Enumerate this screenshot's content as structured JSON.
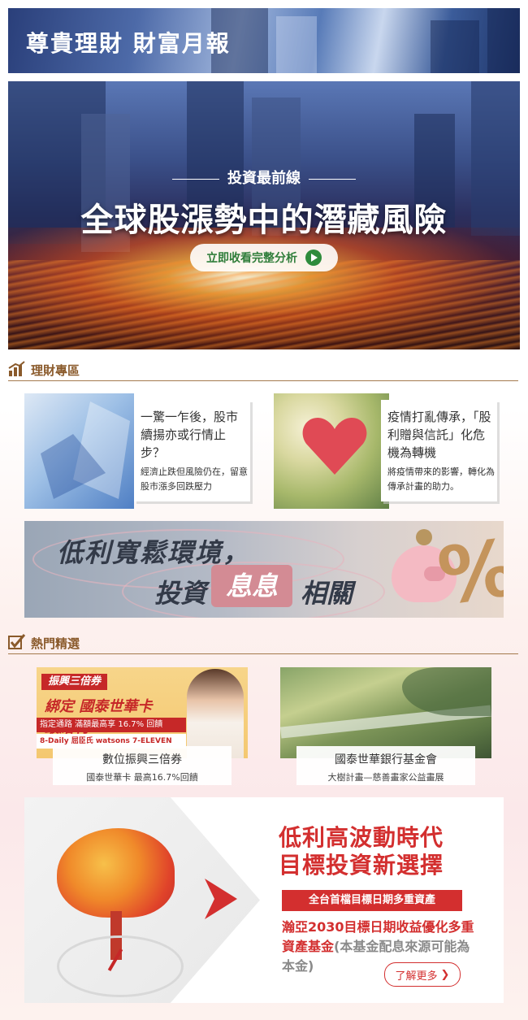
{
  "header": {
    "title": "尊貴理財 財富月報"
  },
  "hero": {
    "kicker": "投資最前線",
    "headline": "全球股漲勢中的潛藏風險",
    "cta_label": "立即收看完整分析"
  },
  "sections": {
    "wealth": {
      "title": "理財專區",
      "icon": "chart-up-icon"
    },
    "hot": {
      "title": "熱門精選",
      "icon": "checkbox-icon"
    }
  },
  "articles": [
    {
      "headline": "一驚一乍後，股市續揚亦或行情止步？",
      "desc": "經濟止跌但風險仍在，留意股市漲多回跌壓力"
    },
    {
      "headline": "疫情打亂傳承，「股利贈與信託」化危機為轉機",
      "desc": "將疫情帶來的影響，轉化為傳承計畫的助力。"
    }
  ],
  "low_rate_banner": {
    "line1": "低利寬鬆環境，",
    "line2a": "投資",
    "line2b": "息息",
    "line2c": "相關",
    "symbol": "%"
  },
  "promos": [
    {
      "tag": "振興三倍券",
      "card_text": "綁定 國泰世華卡 最給利",
      "bar_text": "指定通路 滿額最高享 16.7% 回饋",
      "logos": "8-Daily  屈臣氏  watsons  7-ELEVEN",
      "title": "數位振興三倍券",
      "subtitle": "國泰世華卡 最高16.7%回饋"
    },
    {
      "title": "國泰世華銀行基金會",
      "subtitle": "大樹計畫—慈善畫家公益畫展"
    }
  ],
  "fund_banner": {
    "title1": "低利高波動時代",
    "title2": "目標投資新選擇",
    "badge": "全台首檔目標日期多重資產",
    "name": "瀚亞2030目標日期收益優化多重資產基金",
    "note": "(本基金配息來源可能為本金)",
    "more_label": "了解更多"
  },
  "colors": {
    "accent_red": "#d32f2f",
    "section_brown": "#8a5a2b",
    "cta_green": "#2e8b3c"
  }
}
